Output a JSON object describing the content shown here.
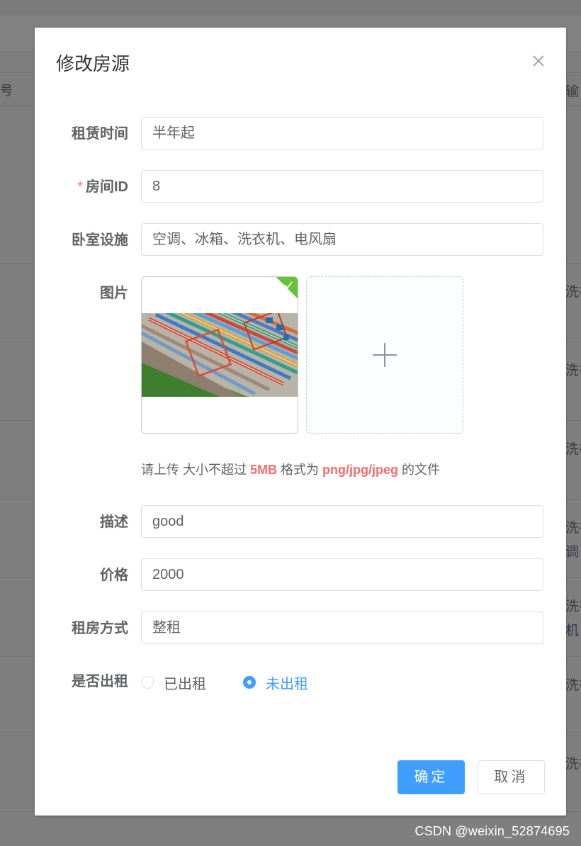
{
  "background": {
    "left_header_text": "号",
    "right_header_text": "输",
    "row_texts": [
      "洗衣",
      "洗衣",
      "洗衣",
      "洗衣",
      "洗衣",
      "洗衣",
      "洗衣"
    ],
    "row_secondary_texts": [
      "调",
      "机"
    ],
    "watermark": "CSDN @weixin_52874695"
  },
  "dialog": {
    "title": "修改房源",
    "close_icon": "close-icon",
    "fields": {
      "lease_time": {
        "label": "租赁时间",
        "value": "半年起"
      },
      "room_id": {
        "required_mark": "*",
        "label": "房间ID",
        "value": "8"
      },
      "facilities": {
        "label": "卧室设施",
        "value": "空调、冰箱、洗衣机、电风扇"
      },
      "image": {
        "label": "图片"
      },
      "description": {
        "label": "描述",
        "value": "good"
      },
      "price": {
        "label": "价格",
        "value": "2000"
      },
      "rent_type": {
        "label": "租房方式",
        "value": "整租"
      },
      "rented": {
        "label": "是否出租",
        "options": [
          "已出租",
          "未出租"
        ],
        "selected": "未出租"
      }
    },
    "upload_tip": {
      "prefix": "请上传 大小不超过 ",
      "size": "5MB",
      "middle": " 格式为 ",
      "formats": "png/jpg/jpeg",
      "suffix": " 的文件"
    },
    "buttons": {
      "confirm": "确定",
      "cancel": "取消"
    }
  },
  "colors": {
    "primary": "#409eff",
    "danger": "#f56c6c",
    "success": "#67c23a",
    "text": "#606266"
  }
}
